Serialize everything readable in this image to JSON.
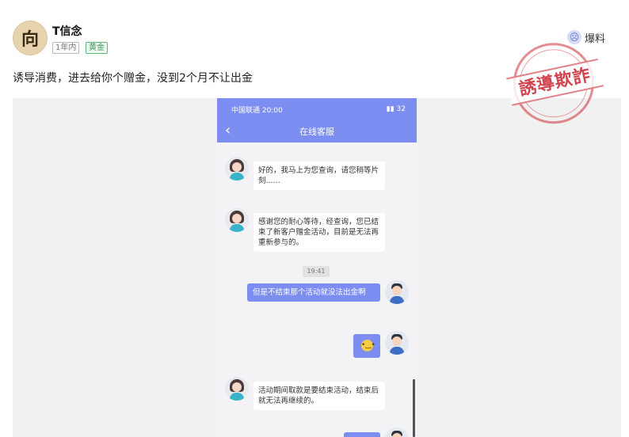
{
  "post": {
    "author_avatar_char": "向",
    "author_name": "T信念",
    "tags": {
      "time": "1年内",
      "badge": "黄金"
    },
    "report_label": "爆料",
    "headline": "诱导消费，进去给你个赠金，没到2个月不让出金",
    "stamp_text": "誘導欺詐"
  },
  "phone": {
    "status_left": "中国联通 20:00",
    "status_right": "32",
    "title": "在线客服",
    "timestamp": "19:41",
    "messages": [
      {
        "side": "left",
        "text": "好的，我马上为您查询，请您稍等片刻......"
      },
      {
        "side": "left",
        "text": "感谢您的耐心等待，经查询，您已结束了新客户赠金活动，目前是无法再重新参与的。"
      },
      {
        "side": "right",
        "text": "但是不结束那个活动就没法出金啊"
      },
      {
        "side": "right",
        "text": ""
      },
      {
        "side": "left",
        "text": "活动期间取款是要结束活动，结束后就无法再继续的。"
      }
    ]
  },
  "colors": {
    "accent": "#7d8ef2",
    "stamp": "#c8242e",
    "tag_badge": "#3d9a56"
  },
  "icons": [
    "author-avatar",
    "sad-face-icon",
    "back-arrow-icon",
    "signal-icon",
    "battery-icon",
    "emoji-icon"
  ]
}
